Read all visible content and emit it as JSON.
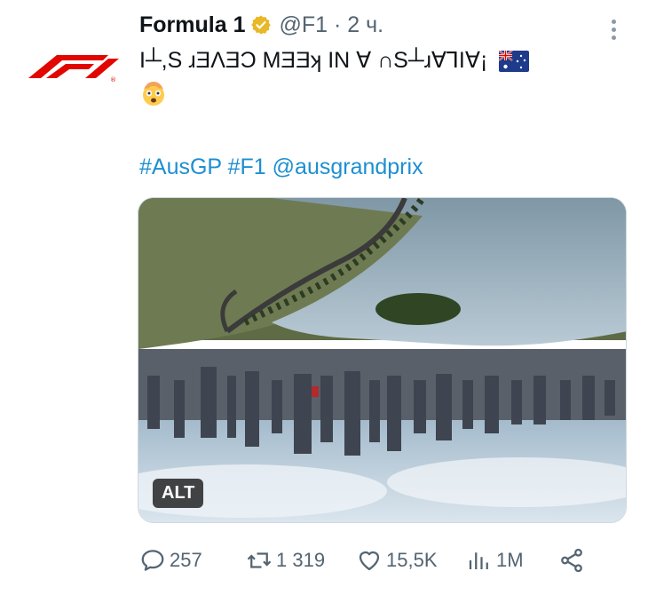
{
  "tweet": {
    "author_name": "Formula 1",
    "handle_time": "@F1 · 2 ч.",
    "text": "I┴,S ɹƎΛƎƆ MƎƎʞ IN ∀ ∩S┴ɹ∀ꞀI∀¡",
    "flag_icon": "australia-flag-icon",
    "emoji_icon": "exploding-head-emoji",
    "hashtags": [
      "#AusGP",
      "#F1",
      "@ausgrandprix"
    ],
    "alt_label": "ALT"
  },
  "actions": {
    "replies": "257",
    "retweets": "1 319",
    "likes": "15,5K",
    "views": "1M"
  },
  "colors": {
    "brand_red": "#e10600",
    "link": "#1d8fd1",
    "verified_gold": "#e8b829",
    "muted": "#536471"
  }
}
